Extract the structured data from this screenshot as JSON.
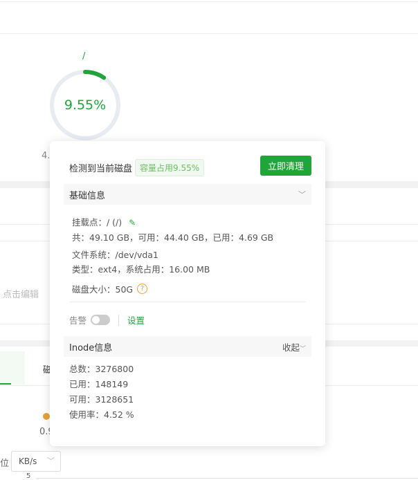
{
  "disk": {
    "mount": "/",
    "percent_label": "9.55%",
    "percent": 9.55,
    "size_partial": "4."
  },
  "background": {
    "edit_hint": "点击编辑",
    "tab_partial": "磁",
    "legend_value_partial": "0.9",
    "unit_label_partial": "位",
    "unit_select": "KB/s",
    "axis_tick": "5"
  },
  "popover": {
    "title": "检测到当前磁盘",
    "usage_tag": "容量占用9.55%",
    "clean_button": "立即清理",
    "basic_section": "基础信息",
    "mount_point": "挂载点：/ (/)",
    "sizes": "共：49.10 GB，可用：44.40 GB，已用：4.69 GB",
    "filesystem": "文件系统：/dev/vda1",
    "type": "类型：ext4，系统占用：16.00 MB",
    "disk_size": "磁盘大小：50G",
    "alert_label": "告警",
    "alert_enabled": false,
    "settings_link": "设置",
    "inode_section": "Inode信息",
    "collapse": "收起",
    "inode_total": "总数：3276800",
    "inode_used": "已用：148149",
    "inode_free": "可用：3128651",
    "inode_usage": "使用率：4.52 %"
  },
  "colors": {
    "accent": "#20a53a",
    "ring_track": "#e8ebf2",
    "warning": "#e6a23c"
  }
}
